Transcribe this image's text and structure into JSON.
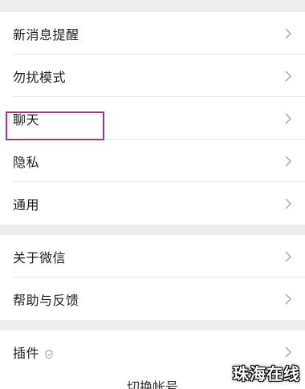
{
  "settings": {
    "groups": [
      {
        "items": [
          {
            "label": "新消息提醒"
          },
          {
            "label": "勿扰模式"
          },
          {
            "label": "聊天"
          },
          {
            "label": "隐私"
          },
          {
            "label": "通用"
          }
        ]
      },
      {
        "items": [
          {
            "label": "关于微信"
          },
          {
            "label": "帮助与反馈"
          }
        ]
      },
      {
        "items": [
          {
            "label": "插件"
          }
        ]
      }
    ],
    "partial_bottom_label": "切换帐号"
  },
  "watermark": "珠海在线",
  "colors": {
    "background": "#ededed",
    "row_background": "#ffffff",
    "text": "#1f1f1f",
    "chevron": "#b2b2b2",
    "highlight_box": "#a23a7a"
  },
  "icons": {
    "chevron": "chevron-right-icon",
    "plugin_badge": "shield-icon"
  }
}
